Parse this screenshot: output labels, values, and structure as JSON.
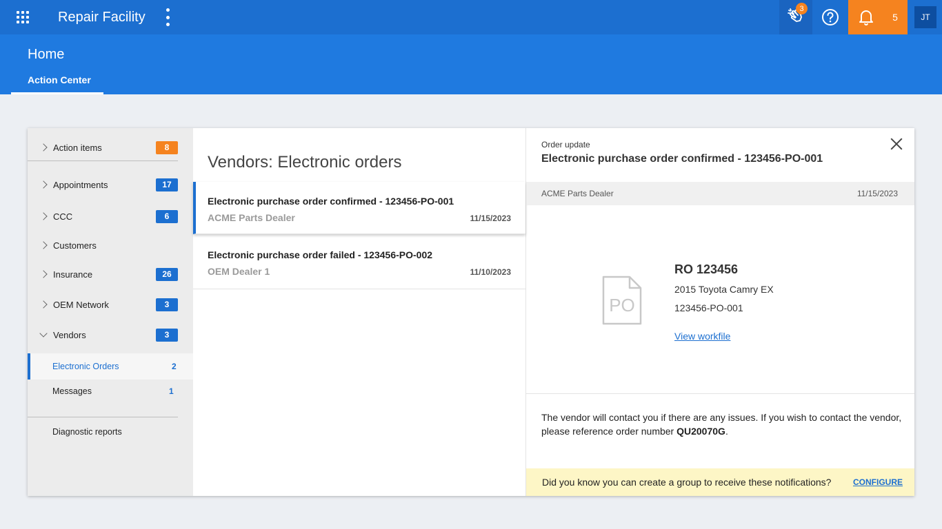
{
  "app": {
    "title": "Repair Facility"
  },
  "topbar": {
    "wave_badge": "3",
    "notification_count": "5",
    "avatar_initials": "JT",
    "icons": [
      "apps-grid-icon",
      "kebab-menu-icon",
      "wave-hand-icon",
      "help-icon",
      "bell-icon"
    ]
  },
  "header": {
    "page_title": "Home",
    "tab": "Action Center"
  },
  "colors": {
    "primary": "#1c6fd0",
    "header": "#1f7ae0",
    "accent_orange": "#f5831f",
    "tip_bg": "#fdf6c6"
  },
  "sidebar": {
    "items": [
      {
        "label": "Action items",
        "count": "8"
      },
      {
        "label": "Appointments",
        "count": "17"
      },
      {
        "label": "CCC",
        "count": "6"
      },
      {
        "label": "Customers",
        "count": ""
      },
      {
        "label": "Insurance",
        "count": "26"
      },
      {
        "label": "OEM Network",
        "count": "3"
      },
      {
        "label": "Vendors",
        "count": "3"
      }
    ],
    "subitems": [
      {
        "label": "Electronic Orders",
        "count": "2"
      },
      {
        "label": "Messages",
        "count": "1"
      }
    ],
    "footer_item": "Diagnostic reports"
  },
  "list": {
    "title": "Vendors: Electronic orders",
    "orders": [
      {
        "title": "Electronic purchase order confirmed - 123456-PO-001",
        "vendor": "ACME Parts Dealer",
        "date": "11/15/2023"
      },
      {
        "title": "Electronic purchase order failed - 123456-PO-002",
        "vendor": "OEM Dealer 1",
        "date": "11/10/2023"
      }
    ]
  },
  "detail": {
    "label": "Order update",
    "title": "Electronic purchase order confirmed - 123456-PO-001",
    "vendor": "ACME Parts Dealer",
    "date": "11/15/2023",
    "icon_text": "PO",
    "ro": "RO 123456",
    "vehicle": "2015 Toyota Camry EX",
    "po_number": "123456-PO-001",
    "workfile_link": "View workfile",
    "note_prefix": "The vendor will contact you if there are any issues. If you wish to contact the vendor, please reference order number ",
    "note_order": "QU20070G",
    "note_suffix": ".",
    "tip": "Did you know you can create a group to receive these notifications?",
    "configure": "CONFIGURE"
  }
}
